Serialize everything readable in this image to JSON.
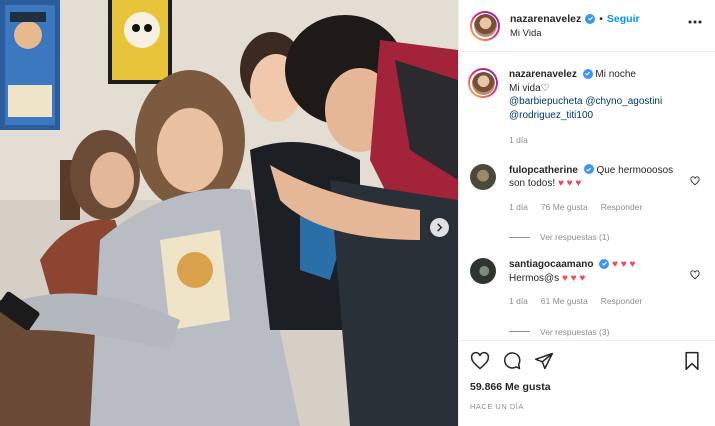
{
  "post": {
    "username": "nazarenavelez",
    "follow_label": "Seguir",
    "separator": "•",
    "location": "Mi Vida",
    "likes": "59.866 Me gusta",
    "time_ago": "HACE UN DÍA"
  },
  "caption": {
    "username": "nazarenavelez",
    "line1": "Mi noche",
    "line2": "Mi vida♡",
    "mention1": "@barbiepucheta",
    "mention2": "@chyno_agostini",
    "mention3": "@rodriguez_titi100",
    "time": "1 día"
  },
  "comments": [
    {
      "username": "fulopcatherine",
      "text": "Que hermooosos son todos!",
      "hearts": "♥ ♥ ♥",
      "time": "1 día",
      "likes": "76 Me gusta",
      "reply_label": "Responder",
      "view_replies": "Ver respuestas (1)",
      "avatar_color": "#4a4a3a"
    },
    {
      "username": "santiagocaamano",
      "hearts_after_name": "♥ ♥ ♥",
      "text": "Hermos@s",
      "hearts": "♥ ♥ ♥",
      "time": "1 día",
      "likes": "61 Me gusta",
      "reply_label": "Responder",
      "view_replies": "Ver respuestas (3)",
      "avatar_color": "#2e3530"
    }
  ],
  "colors": {
    "accent": "#0095f6",
    "verified": "#3897f0",
    "heart": "#ed4956",
    "muted": "#8e8e8e"
  },
  "icons": {
    "like": "heart-icon",
    "comment": "comment-icon",
    "share": "paper-plane-icon",
    "save": "bookmark-icon",
    "more": "more-options-icon",
    "next": "chevron-right-icon"
  }
}
